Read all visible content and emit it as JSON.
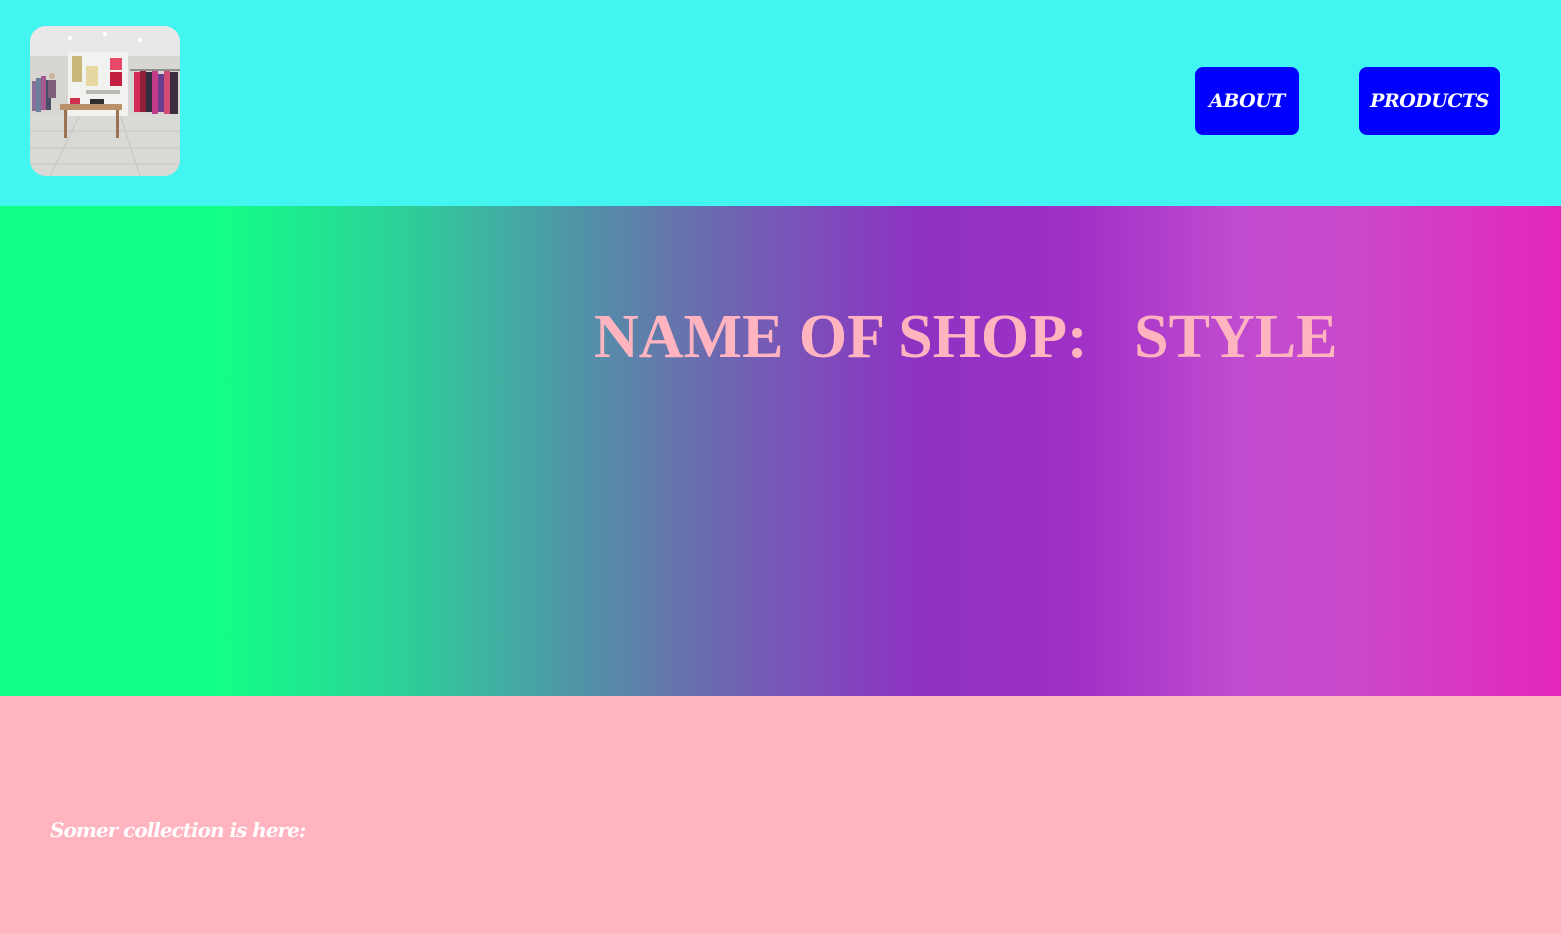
{
  "header": {
    "logo_alt": "store interior photo",
    "nav": {
      "about_label": "ABOUT",
      "products_label": "PRODUCTS"
    }
  },
  "hero": {
    "title": "NAME OF SHOP:   STYLE"
  },
  "collection": {
    "text": "Somer collection is here:"
  },
  "colors": {
    "header_bg": "#43f5f0",
    "nav_button_bg": "#0000ff",
    "hero_title": "#ffb4c0",
    "bottom_bg": "#ffb4bf"
  }
}
